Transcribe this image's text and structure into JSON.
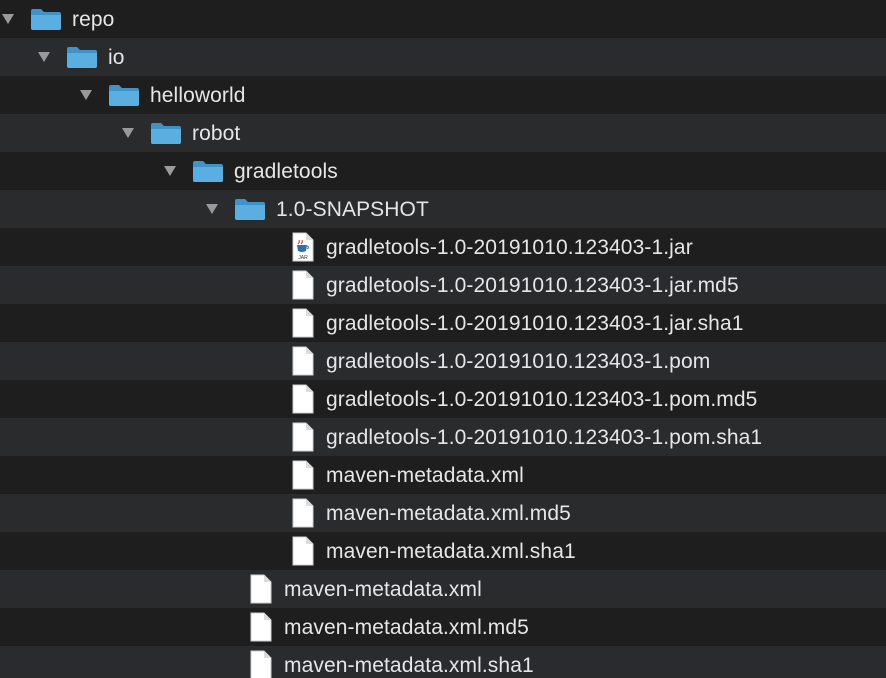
{
  "tree": [
    {
      "label": "repo",
      "kind": "folder",
      "depth": 0,
      "expanded": true
    },
    {
      "label": "io",
      "kind": "folder",
      "depth": 1,
      "expanded": true
    },
    {
      "label": "helloworld",
      "kind": "folder",
      "depth": 2,
      "expanded": true
    },
    {
      "label": "robot",
      "kind": "folder",
      "depth": 3,
      "expanded": true
    },
    {
      "label": "gradletools",
      "kind": "folder",
      "depth": 4,
      "expanded": true
    },
    {
      "label": "1.0-SNAPSHOT",
      "kind": "folder",
      "depth": 5,
      "expanded": true
    },
    {
      "label": "gradletools-1.0-20191010.123403-1.jar",
      "kind": "jar",
      "depth": 6,
      "icon_text": "JAR"
    },
    {
      "label": "gradletools-1.0-20191010.123403-1.jar.md5",
      "kind": "file",
      "depth": 6
    },
    {
      "label": "gradletools-1.0-20191010.123403-1.jar.sha1",
      "kind": "file",
      "depth": 6
    },
    {
      "label": "gradletools-1.0-20191010.123403-1.pom",
      "kind": "file",
      "depth": 6
    },
    {
      "label": "gradletools-1.0-20191010.123403-1.pom.md5",
      "kind": "file",
      "depth": 6
    },
    {
      "label": "gradletools-1.0-20191010.123403-1.pom.sha1",
      "kind": "file",
      "depth": 6
    },
    {
      "label": "maven-metadata.xml",
      "kind": "file",
      "depth": 6
    },
    {
      "label": "maven-metadata.xml.md5",
      "kind": "file",
      "depth": 6
    },
    {
      "label": "maven-metadata.xml.sha1",
      "kind": "file",
      "depth": 6
    },
    {
      "label": "maven-metadata.xml",
      "kind": "file",
      "depth": 5
    },
    {
      "label": "maven-metadata.xml.md5",
      "kind": "file",
      "depth": 5
    },
    {
      "label": "maven-metadata.xml.sha1",
      "kind": "file",
      "depth": 5
    }
  ],
  "colors": {
    "folder": "#5aaee0",
    "folder_tab": "#3f93c9",
    "text": "#e6e6e6",
    "row_alt": "#2a2b2c",
    "background": "#1e1e1e",
    "disclosure": "#9a9a9a"
  },
  "icons": {
    "disclosure": "disclosure-triangle-icon",
    "folder": "folder-icon",
    "file": "document-icon",
    "jar": "java-jar-icon"
  }
}
